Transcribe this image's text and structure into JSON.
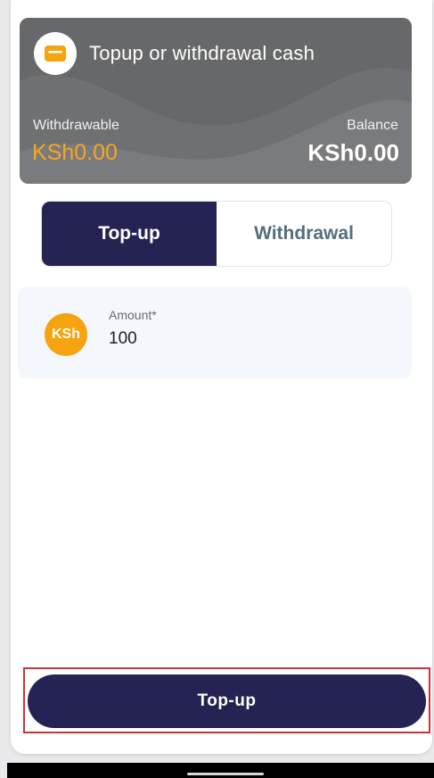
{
  "card": {
    "icon": "wallet-card-icon",
    "title": "Topup or withdrawal cash",
    "withdrawable_label": "Withdrawable",
    "withdrawable_value": "KSh0.00",
    "balance_label": "Balance",
    "balance_value": "KSh0.00"
  },
  "toggle": {
    "options": [
      {
        "label": "Top-up",
        "selected": true
      },
      {
        "label": "Withdrawal",
        "selected": false
      }
    ]
  },
  "amount": {
    "currency_badge": "KSh",
    "label": "Amount*",
    "value": "100"
  },
  "action": {
    "submit_label": "Top-up"
  },
  "colors": {
    "primary": "#252353",
    "accent": "#f5a623",
    "highlight_border": "#d32f2f"
  }
}
